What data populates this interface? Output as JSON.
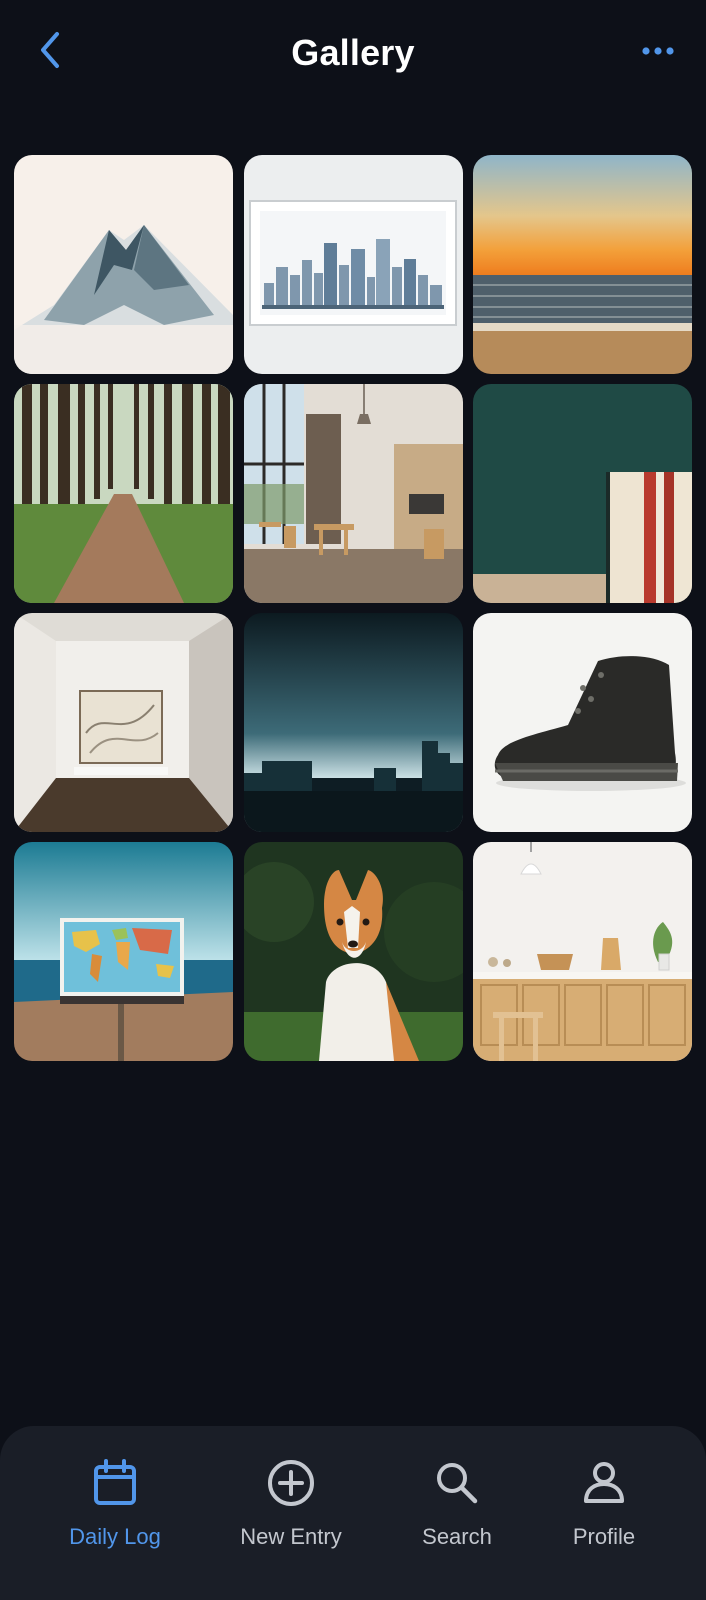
{
  "header": {
    "title": "Gallery",
    "back_icon": "chevron-left-icon",
    "more_icon": "more-horizontal-icon"
  },
  "colors": {
    "background": "#0d1018",
    "accent": "#5196ea",
    "nav_background": "#1a1e27",
    "nav_inactive": "#c3c7ce"
  },
  "gallery": {
    "items": [
      {
        "subject": "mountain"
      },
      {
        "subject": "city-skyline-print"
      },
      {
        "subject": "sunset-beach"
      },
      {
        "subject": "forest-path"
      },
      {
        "subject": "cafe-interior"
      },
      {
        "subject": "green-wall-books"
      },
      {
        "subject": "gallery-room-artwork"
      },
      {
        "subject": "dark-skyline"
      },
      {
        "subject": "hiking-boot"
      },
      {
        "subject": "world-map-beach"
      },
      {
        "subject": "dog-portrait"
      },
      {
        "subject": "kitchen-cabinets"
      }
    ]
  },
  "bottom_nav": {
    "items": [
      {
        "label": "Daily Log",
        "icon": "calendar-icon",
        "active": true
      },
      {
        "label": "New Entry",
        "icon": "plus-circle-icon",
        "active": false
      },
      {
        "label": "Search",
        "icon": "search-icon",
        "active": false
      },
      {
        "label": "Profile",
        "icon": "user-icon",
        "active": false
      }
    ]
  }
}
